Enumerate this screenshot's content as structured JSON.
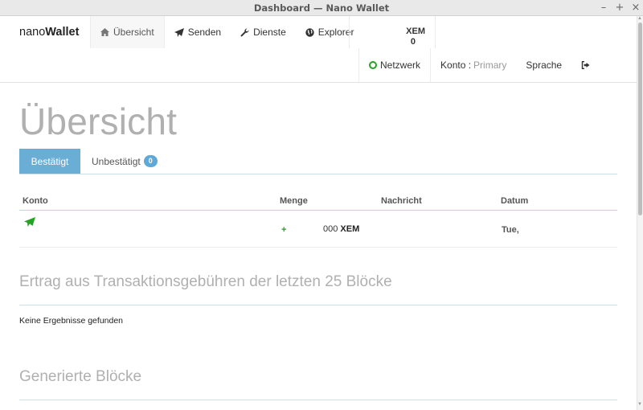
{
  "window": {
    "title": "Dashboard — Nano Wallet",
    "controls": {
      "minimize": "–",
      "maximize": "+",
      "close": "×"
    }
  },
  "nav": {
    "brand_light": "nano",
    "brand_bold": "Wallet",
    "items": [
      {
        "label": "Übersicht",
        "icon": "home-icon"
      },
      {
        "label": "Senden",
        "icon": "paper-plane-icon"
      },
      {
        "label": "Dienste",
        "icon": "wrench-icon"
      },
      {
        "label": "Explorer",
        "icon": "globe-icon"
      }
    ],
    "balance_value": "0",
    "balance_unit": "XEM",
    "network_label": "Netzwerk",
    "network_status_color": "#24a124",
    "account_label": "Konto :",
    "account_value": "Primary",
    "language_label": "Sprache",
    "logout_icon": "sign-out-icon"
  },
  "main": {
    "title": "Übersicht",
    "tabs": [
      {
        "label": "Bestätigt",
        "active": true
      },
      {
        "label": "Unbestätigt",
        "badge": "0",
        "active": false
      }
    ],
    "table": {
      "headers": [
        "Konto",
        "Menge",
        "Nachricht",
        "Datum"
      ],
      "rows": [
        {
          "type_icon": "paper-plane-icon",
          "sign": "+",
          "amount": "000",
          "unit": "XEM",
          "message": "",
          "date": "Tue,"
        }
      ]
    },
    "fees_title": "Ertrag aus Transaktionsgebühren der letzten 25 Blöcke",
    "fees_empty": "Keine Ergebnisse gefunden",
    "blocks_title": "Generierte Blöcke"
  },
  "colors": {
    "accent": "#6aaed6",
    "badge": "#5ea9d8",
    "positive": "#23a223",
    "muted_heading": "#b0b0b0"
  }
}
